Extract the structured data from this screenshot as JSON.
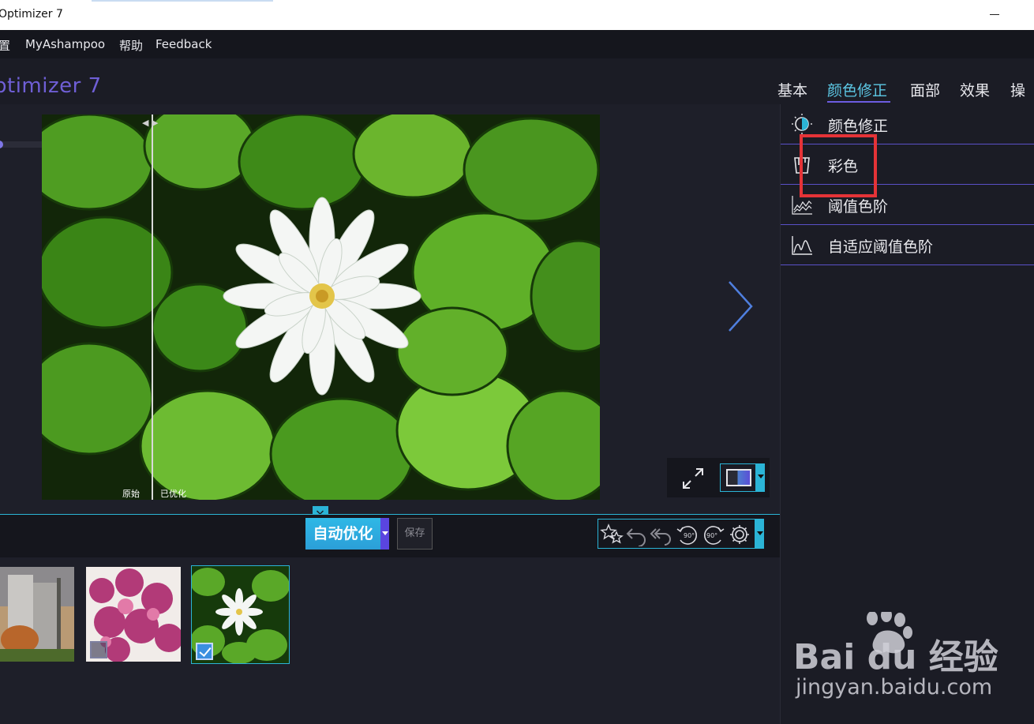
{
  "window": {
    "title": "Optimizer 7"
  },
  "menu": {
    "items": [
      "置",
      "MyAshampoo",
      "帮助",
      "Feedback"
    ]
  },
  "header": {
    "app_title": "ptimizer 7",
    "tabs": [
      {
        "label": "基本",
        "active": false
      },
      {
        "label": "颜色修正",
        "active": true
      },
      {
        "label": "面部",
        "active": false
      },
      {
        "label": "效果",
        "active": false
      },
      {
        "label": "操作",
        "active": false
      }
    ]
  },
  "preview": {
    "zoom_plus": "+",
    "original_label": "原始",
    "optimized_label": "已优化"
  },
  "actions": {
    "auto_optimize_label": "自动优化",
    "save_label": "保存",
    "rotate_left_label": "90°",
    "rotate_right_label": "90°"
  },
  "thumbnails": [
    {
      "name": "city-building",
      "checked": false,
      "selected": false
    },
    {
      "name": "pink-blossoms",
      "checked": false,
      "selected": false
    },
    {
      "name": "water-lily",
      "checked": true,
      "selected": true
    }
  ],
  "right_panel": {
    "items": [
      {
        "label": "颜色修正",
        "icon": "contrast-icon"
      },
      {
        "label": "彩色",
        "icon": "paint-bucket-icon"
      },
      {
        "label": "阈值色阶",
        "icon": "levels-icon"
      },
      {
        "label": "自适应阈值色阶",
        "icon": "adaptive-levels-icon"
      }
    ]
  },
  "watermark": {
    "brand": "Bai du 经验",
    "url": "jingyan.baidu.com"
  },
  "colors": {
    "accent": "#2bb4d6",
    "tab_active": "#5cc7e4",
    "title": "#6f5fd6",
    "highlight": "#e53337"
  }
}
